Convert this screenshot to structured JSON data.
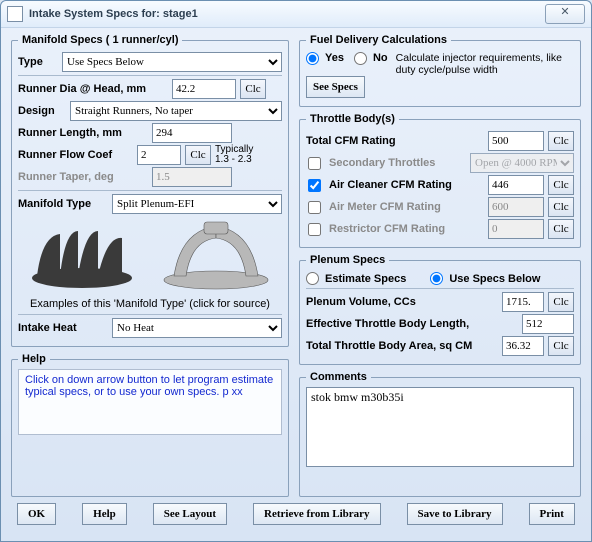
{
  "window": {
    "title": "Intake System Specs for: stage1"
  },
  "manifold": {
    "legend": "Manifold Specs ( 1 runner/cyl)",
    "type_label": "Type",
    "type_value": "Use Specs Below",
    "runner_dia_label": "Runner Dia @ Head, mm",
    "runner_dia_value": "42.2",
    "design_label": "Design",
    "design_value": "Straight Runners, No taper",
    "runner_len_label": "Runner Length, mm",
    "runner_len_value": "294",
    "runner_flow_label": "Runner Flow Coef",
    "runner_flow_value": "2",
    "runner_flow_hint1": "Typically",
    "runner_flow_hint2": "1.3 - 2.3",
    "runner_taper_label": "Runner Taper, deg",
    "runner_taper_value": "1.5",
    "manifold_type_label": "Manifold Type",
    "manifold_type_value": "Split Plenum-EFI",
    "example_caption": "Examples of this 'Manifold Type' (click for source)",
    "intake_heat_label": "Intake Heat",
    "intake_heat_value": "No Heat",
    "clc": "Clc"
  },
  "help": {
    "legend": "Help",
    "text": "Click on down arrow button to let program estimate typical specs, or to use your own specs.  p xx"
  },
  "fuel": {
    "legend": "Fuel Delivery Calculations",
    "yes": "Yes",
    "no": "No",
    "note": "Calculate injector requirements, like duty cycle/pulse width",
    "see_specs": "See Specs"
  },
  "tb": {
    "legend": "Throttle Body(s)",
    "total_cfm_label": "Total CFM Rating",
    "total_cfm_value": "500",
    "sec_label": "Secondary Throttles",
    "sec_value": "Open @ 4000 RPM",
    "air_cleaner_label": "Air Cleaner CFM Rating",
    "air_cleaner_value": "446",
    "air_meter_label": "Air Meter CFM Rating",
    "air_meter_value": "600",
    "restrictor_label": "Restrictor CFM Rating",
    "restrictor_value": "0",
    "clc": "Clc"
  },
  "plenum": {
    "legend": "Plenum Specs",
    "estimate": "Estimate Specs",
    "use_below": "Use Specs Below",
    "vol_label": "Plenum Volume, CCs",
    "vol_value": "1715.",
    "eff_label": "Effective Throttle Body Length,",
    "eff_value": "512",
    "area_label": "Total Throttle Body Area, sq CM",
    "area_value": "36.32",
    "clc": "Clc"
  },
  "comments": {
    "legend": "Comments",
    "value": "stok bmw m30b35i"
  },
  "footer": {
    "ok": "OK",
    "help": "Help",
    "see_layout": "See Layout",
    "retrieve": "Retrieve from Library",
    "save": "Save to Library",
    "print": "Print"
  }
}
